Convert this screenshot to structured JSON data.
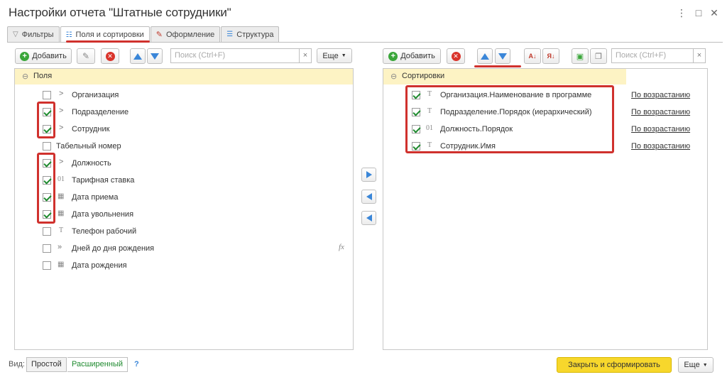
{
  "window": {
    "title": "Настройки отчета \"Штатные сотрудники\"",
    "controls": [
      "⋮",
      "□",
      "✕"
    ]
  },
  "tabs": [
    {
      "label": "Фильтры",
      "icon": "filter-icon"
    },
    {
      "label": "Поля и сортировки",
      "icon": "fields-sort-icon",
      "active": true
    },
    {
      "label": "Оформление",
      "icon": "brush-icon"
    },
    {
      "label": "Структура",
      "icon": "structure-icon"
    }
  ],
  "left": {
    "add_label": "Добавить",
    "search_placeholder": "Поиск (Ctrl+F)",
    "clear": "×",
    "more_label": "Еще",
    "header": "Поля",
    "items": [
      {
        "label": "Организация",
        "checked": false,
        "icon": "chevron-right-icon",
        "type": ">"
      },
      {
        "label": "Подразделение",
        "checked": true,
        "icon": "chevron-right-icon",
        "type": ">"
      },
      {
        "label": "Сотрудник",
        "checked": true,
        "icon": "chevron-right-icon",
        "type": ">"
      },
      {
        "label": "Табельный номер",
        "checked": false,
        "icon": "",
        "type": ""
      },
      {
        "label": "Должность",
        "checked": true,
        "icon": "chevron-right-icon",
        "type": ">"
      },
      {
        "label": "Тарифная ставка",
        "checked": true,
        "icon": "number-type-icon",
        "type": "01"
      },
      {
        "label": "Дата приема",
        "checked": true,
        "icon": "calendar-icon",
        "type": "▦"
      },
      {
        "label": "Дата увольнения",
        "checked": true,
        "icon": "calendar-icon",
        "type": "▦"
      },
      {
        "label": "Телефон рабочий",
        "checked": false,
        "icon": "text-type-icon",
        "type": "T"
      },
      {
        "label": "Дней до дня рождения",
        "checked": false,
        "icon": "double-chevron-icon",
        "type": "»",
        "fx": "fx"
      },
      {
        "label": "Дата рождения",
        "checked": false,
        "icon": "calendar-icon",
        "type": "▦"
      }
    ]
  },
  "right": {
    "add_label": "Добавить",
    "search_placeholder": "Поиск (Ctrl+F)",
    "clear": "×",
    "more_label": "Еще",
    "header": "Сортировки",
    "items": [
      {
        "label": "Организация.Наименование в программе",
        "checked": true,
        "type": "T",
        "order": "По возрастанию"
      },
      {
        "label": "Подразделение.Порядок (иерархический)",
        "checked": true,
        "type": "T",
        "order": "По возрастанию"
      },
      {
        "label": "Должность.Порядок",
        "checked": true,
        "type": "01",
        "order": "По возрастанию"
      },
      {
        "label": "Сотрудник.Имя",
        "checked": true,
        "type": "T",
        "order": "По возрастанию"
      }
    ]
  },
  "footer": {
    "view_label": "Вид:",
    "simple": "Простой",
    "advanced": "Расширенный",
    "help": "?",
    "close_build": "Закрыть и сформировать",
    "more_label": "Еще"
  },
  "colors": {
    "accent_red": "#d0312d",
    "header_yellow": "#fdf3c4",
    "primary_yellow": "#f7d72c",
    "check_green": "#1e8a2e",
    "arrow_blue": "#3a86d8"
  }
}
